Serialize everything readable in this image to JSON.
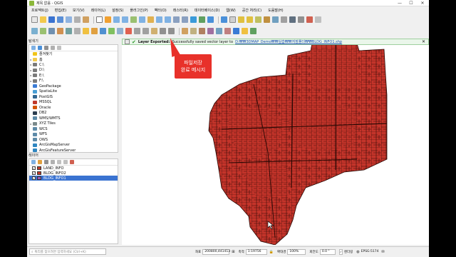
{
  "window": {
    "title": "제목 없음 - QGIS",
    "minimize": "—",
    "maximize": "☐",
    "close": "✕"
  },
  "menu": [
    "프로젝트(J)",
    "편집(E)",
    "보기(V)",
    "레이어(L)",
    "설정(S)",
    "플러그인(P)",
    "벡터(O)",
    "래스터(R)",
    "데이터베이스(D)",
    "웹(W)",
    "공간 처리(C)",
    "도움말(H)"
  ],
  "browser": {
    "title": "탐색기",
    "items": [
      {
        "label": "즐겨찾기",
        "arrow": "",
        "icon": "star-icon",
        "color": "#f0c419"
      },
      {
        "label": "홈",
        "arrow": "▸",
        "icon": "folder-icon",
        "color": "#f2c94c"
      },
      {
        "label": "C:\\",
        "arrow": "▸",
        "icon": "drive-icon",
        "color": "#7a7a7a"
      },
      {
        "label": "D:\\",
        "arrow": "▸",
        "icon": "drive-icon",
        "color": "#7a7a7a"
      },
      {
        "label": "E:\\",
        "arrow": "▸",
        "icon": "drive-icon",
        "color": "#7a7a7a"
      },
      {
        "label": "F:\\",
        "arrow": "▸",
        "icon": "drive-icon",
        "color": "#7a7a7a"
      },
      {
        "label": "GeoPackage",
        "arrow": "",
        "icon": "geopackage-icon",
        "color": "#3a7bd5"
      },
      {
        "label": "SpatiaLite",
        "arrow": "",
        "icon": "spatialite-icon",
        "color": "#4a9fd4"
      },
      {
        "label": "PostGIS",
        "arrow": "",
        "icon": "postgis-icon",
        "color": "#336791"
      },
      {
        "label": "MSSQL",
        "arrow": "",
        "icon": "mssql-icon",
        "color": "#c0392b"
      },
      {
        "label": "Oracle",
        "arrow": "",
        "icon": "oracle-icon",
        "color": "#d35400"
      },
      {
        "label": "DB2",
        "arrow": "",
        "icon": "db2-icon",
        "color": "#2c3e50"
      },
      {
        "label": "WMS/WMTS",
        "arrow": "",
        "icon": "wms-icon",
        "color": "#5d8aa8"
      },
      {
        "label": "XYZ Tiles",
        "arrow": "▸",
        "icon": "xyz-tiles-icon",
        "color": "#7b8a8b"
      },
      {
        "label": "WCS",
        "arrow": "",
        "icon": "wcs-icon",
        "color": "#5d8aa8"
      },
      {
        "label": "WFS",
        "arrow": "",
        "icon": "wfs-icon",
        "color": "#5d8aa8"
      },
      {
        "label": "OWS",
        "arrow": "",
        "icon": "ows-icon",
        "color": "#5d8aa8"
      },
      {
        "label": "ArcGisMapServer",
        "arrow": "",
        "icon": "arcgis-icon",
        "color": "#2e86c1"
      },
      {
        "label": "ArcGisFeatureServer",
        "arrow": "",
        "icon": "arcgis-icon",
        "color": "#2e86c1"
      }
    ]
  },
  "layers": {
    "title": "레이어",
    "items": [
      {
        "name": "LAND_INFO",
        "color": "#c0392b",
        "checked": "✓",
        "selected": false
      },
      {
        "name": "BLDG_INFO2",
        "color": "#c0392b",
        "checked": "✓",
        "selected": false
      },
      {
        "name": "BLDG_INFO1",
        "color": "#9b59b6",
        "checked": "✓",
        "selected": true
      }
    ]
  },
  "message": {
    "title": "Layer Exported:",
    "text": "Successfully saved vector layer to",
    "link": "D:₩₩3DMAP_Demo₩₩실습₩₩저장폴더₩₩BLDG_INFO1.shp",
    "close": "✕"
  },
  "annotation": {
    "line1": "파일저장",
    "line2": "완료 메시지"
  },
  "status": {
    "search_placeholder": "쿼리를 찾으려면 입력하세요 (Ctrl+K)",
    "coord_label": "좌표",
    "coord_value": "200800,441413",
    "scale_label": "축척",
    "scale_value": "1:19756",
    "magnifier_label": "확대경",
    "magnifier_value": "100%",
    "rotation_label": "회전도",
    "rotation_value": "0.0 °",
    "render_label": "렌더링",
    "crs": "EPSG:5174"
  },
  "colors": {
    "parcel_fill": "#c4342a",
    "parcel_stroke": "#3a0c08",
    "accent": "#3a73d1"
  }
}
